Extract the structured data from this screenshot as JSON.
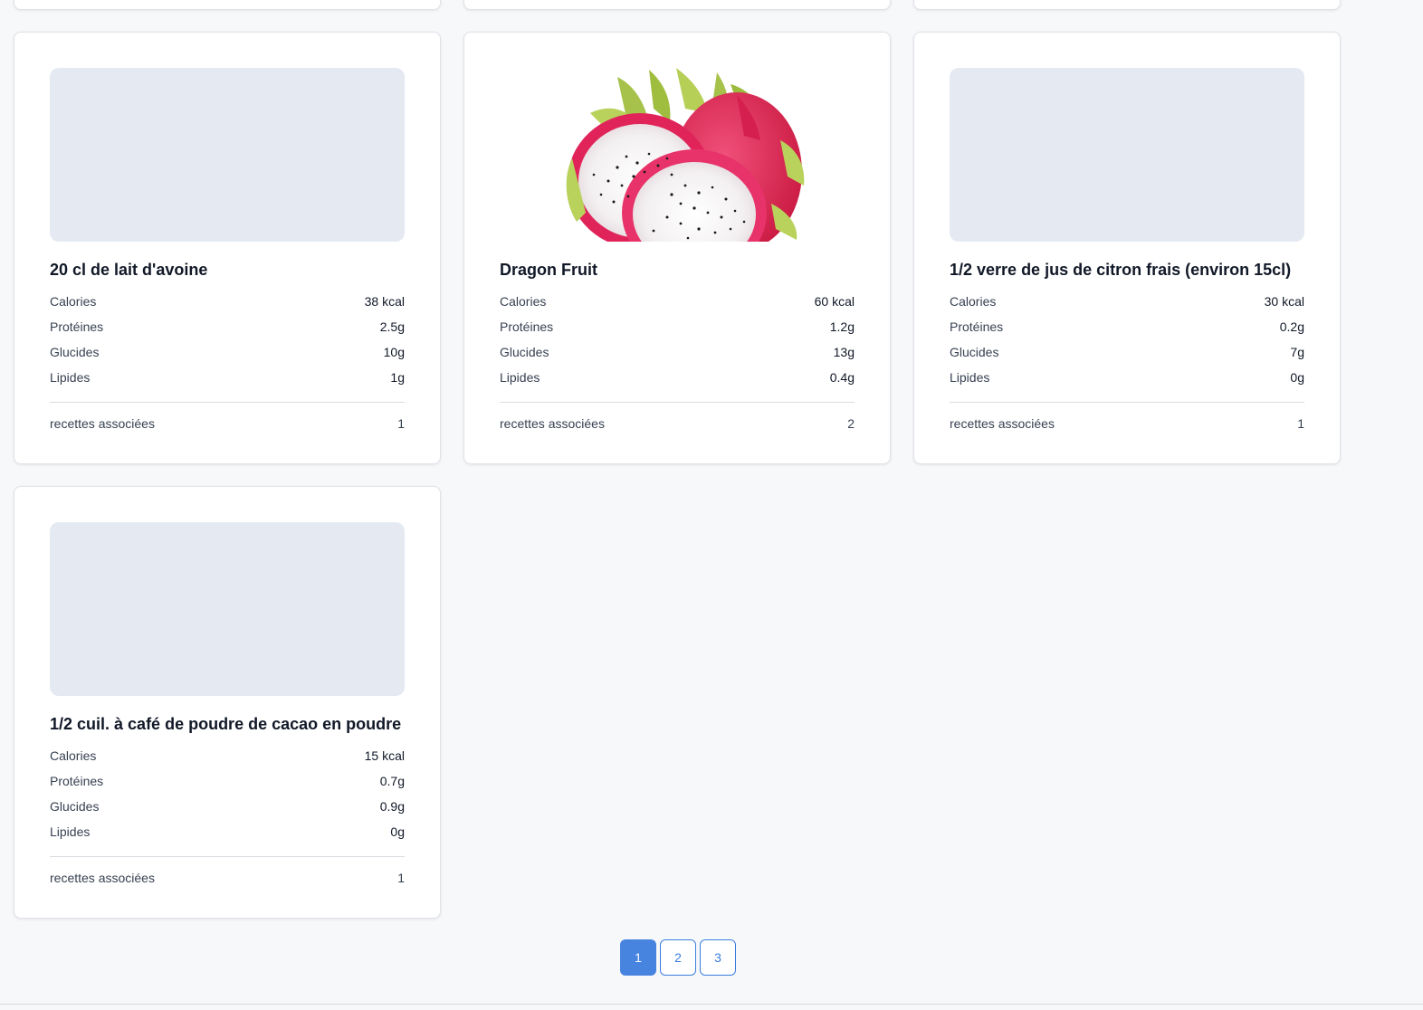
{
  "cards": [
    {
      "title": "20 cl de lait d'avoine",
      "has_image": false,
      "stats": [
        {
          "label": "Calories",
          "value": "38 kcal"
        },
        {
          "label": "Protéines",
          "value": "2.5g"
        },
        {
          "label": "Glucides",
          "value": "10g"
        },
        {
          "label": "Lipides",
          "value": "1g"
        }
      ],
      "footer": {
        "label": "recettes associées",
        "value": "1"
      }
    },
    {
      "title": "Dragon Fruit",
      "has_image": true,
      "stats": [
        {
          "label": "Calories",
          "value": "60 kcal"
        },
        {
          "label": "Protéines",
          "value": "1.2g"
        },
        {
          "label": "Glucides",
          "value": "13g"
        },
        {
          "label": "Lipides",
          "value": "0.4g"
        }
      ],
      "footer": {
        "label": "recettes associées",
        "value": "2"
      }
    },
    {
      "title": "1/2 verre de jus de citron frais (environ 15cl)",
      "has_image": false,
      "stats": [
        {
          "label": "Calories",
          "value": "30 kcal"
        },
        {
          "label": "Protéines",
          "value": "0.2g"
        },
        {
          "label": "Glucides",
          "value": "7g"
        },
        {
          "label": "Lipides",
          "value": "0g"
        }
      ],
      "footer": {
        "label": "recettes associées",
        "value": "1"
      }
    },
    {
      "title": "1/2 cuil. à café de poudre de cacao en poudre",
      "has_image": false,
      "stats": [
        {
          "label": "Calories",
          "value": "15 kcal"
        },
        {
          "label": "Protéines",
          "value": "0.7g"
        },
        {
          "label": "Glucides",
          "value": "0.9g"
        },
        {
          "label": "Lipides",
          "value": "0g"
        }
      ],
      "footer": {
        "label": "recettes associées",
        "value": "1"
      }
    }
  ],
  "pagination": {
    "pages": [
      "1",
      "2",
      "3"
    ],
    "active": "1"
  },
  "colors": {
    "accent": "#4684e0",
    "placeholder": "#e5e9f2",
    "background": "#f7f8fa"
  }
}
